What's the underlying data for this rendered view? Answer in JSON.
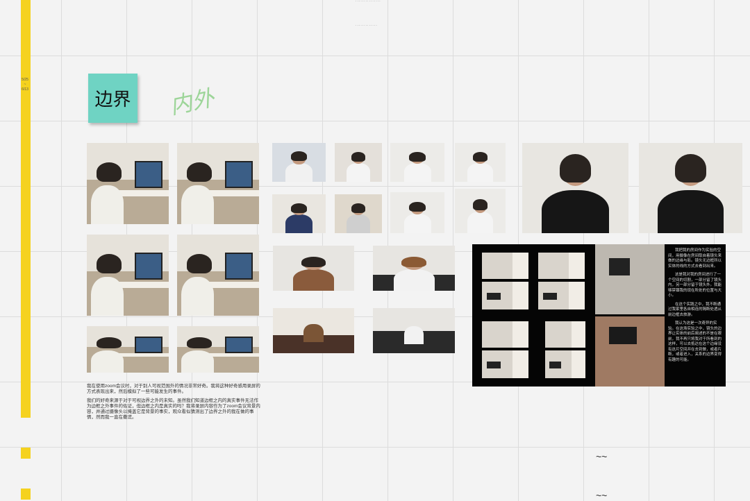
{
  "board": {
    "date_range": [
      "5/25",
      "~",
      "6/13"
    ],
    "sticky_note": "边界",
    "handwriting": "内外",
    "top_marks": [
      "· · · · · · · · · · · · · · ·",
      "· · · · · · · · · · · · ·"
    ],
    "description": [
      "我在使用zoom会议时，对于别人可视范围外的情况非常好奇。我将这种好奇感用录屏的方式表现出来，然后模拟了一些可能发生的事件。",
      "我们的好奇来源于对于可视边界之外的未知。虽然我们知道边框之内的真实事件无法作为边框之外事件的佐证，但边框之内是真实的吗？我将录屏内容作为了zoom会议背景内容，并通过摄像头以掩盖它是背景的事实，观众看似猜测出了边界之外的我在做的事情，然而我一直在撒谎。"
    ],
    "dark_panel_text": [
      "我把我的房间作为实验的空间，用摄像在房间取自着镜头来做的边缘与影。镜头无边框所以实体的线的方式去看到出来。",
      "这是我对我的房间进行了一个空间的切割，一部分留了镜头内，另一部分留于镜头外。我能够禁锢我的现在所处的位置与大小。",
      "在这个实践之中，我不断通过我家里各自相连的隔断处透从前边框去旅游。",
      "我认为这是一次奇异的实验。在这场实验之中，镜头的边界让实体的前后阐述的不是在眼前，我不再只将我对于所看到的这样，可以去抵达在这个边缘没有这片空间并在去到做，或者片断，或者进入，关系的边界变得有趣的可能。"
    ],
    "decor_marks": [
      "~~",
      "~~"
    ]
  },
  "colors": {
    "accent_yellow": "#f5d21f",
    "sticky": "#6fd3c3",
    "handwriting": "#8fd08a",
    "panel_bg": "#050505"
  },
  "photo_groups": [
    "desk-scene-grid",
    "eating-scene-grid",
    "bedroom-scene-grid",
    "webcam-bedroom-pair",
    "dark-montage-panel"
  ]
}
